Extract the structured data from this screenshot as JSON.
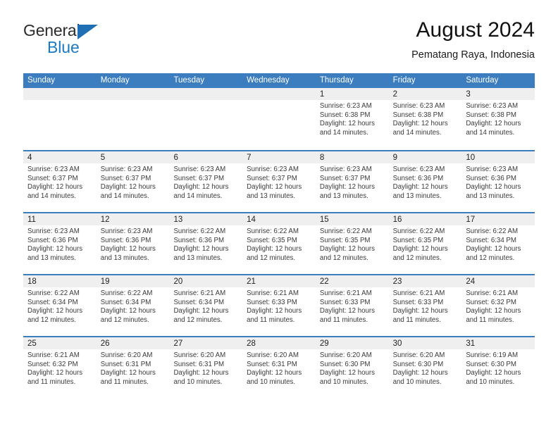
{
  "brand": {
    "name_part1": "General",
    "name_part2": "Blue",
    "logo_icon": "blue-triangle-logo"
  },
  "header": {
    "title": "August 2024",
    "subtitle": "Pematang Raya, Indonesia"
  },
  "colors": {
    "header_blue": "#3b7dbf",
    "brand_blue": "#1c7ac4",
    "daynum_band": "#efefef",
    "text": "#3a3a3a"
  },
  "calendar": {
    "day_headers": [
      "Sunday",
      "Monday",
      "Tuesday",
      "Wednesday",
      "Thursday",
      "Friday",
      "Saturday"
    ],
    "weeks": [
      [
        {
          "day": "",
          "sunrise": "",
          "sunset": "",
          "daylight1": "",
          "daylight2": ""
        },
        {
          "day": "",
          "sunrise": "",
          "sunset": "",
          "daylight1": "",
          "daylight2": ""
        },
        {
          "day": "",
          "sunrise": "",
          "sunset": "",
          "daylight1": "",
          "daylight2": ""
        },
        {
          "day": "",
          "sunrise": "",
          "sunset": "",
          "daylight1": "",
          "daylight2": ""
        },
        {
          "day": "1",
          "sunrise": "Sunrise: 6:23 AM",
          "sunset": "Sunset: 6:38 PM",
          "daylight1": "Daylight: 12 hours",
          "daylight2": "and 14 minutes."
        },
        {
          "day": "2",
          "sunrise": "Sunrise: 6:23 AM",
          "sunset": "Sunset: 6:38 PM",
          "daylight1": "Daylight: 12 hours",
          "daylight2": "and 14 minutes."
        },
        {
          "day": "3",
          "sunrise": "Sunrise: 6:23 AM",
          "sunset": "Sunset: 6:38 PM",
          "daylight1": "Daylight: 12 hours",
          "daylight2": "and 14 minutes."
        }
      ],
      [
        {
          "day": "4",
          "sunrise": "Sunrise: 6:23 AM",
          "sunset": "Sunset: 6:37 PM",
          "daylight1": "Daylight: 12 hours",
          "daylight2": "and 14 minutes."
        },
        {
          "day": "5",
          "sunrise": "Sunrise: 6:23 AM",
          "sunset": "Sunset: 6:37 PM",
          "daylight1": "Daylight: 12 hours",
          "daylight2": "and 14 minutes."
        },
        {
          "day": "6",
          "sunrise": "Sunrise: 6:23 AM",
          "sunset": "Sunset: 6:37 PM",
          "daylight1": "Daylight: 12 hours",
          "daylight2": "and 14 minutes."
        },
        {
          "day": "7",
          "sunrise": "Sunrise: 6:23 AM",
          "sunset": "Sunset: 6:37 PM",
          "daylight1": "Daylight: 12 hours",
          "daylight2": "and 13 minutes."
        },
        {
          "day": "8",
          "sunrise": "Sunrise: 6:23 AM",
          "sunset": "Sunset: 6:37 PM",
          "daylight1": "Daylight: 12 hours",
          "daylight2": "and 13 minutes."
        },
        {
          "day": "9",
          "sunrise": "Sunrise: 6:23 AM",
          "sunset": "Sunset: 6:36 PM",
          "daylight1": "Daylight: 12 hours",
          "daylight2": "and 13 minutes."
        },
        {
          "day": "10",
          "sunrise": "Sunrise: 6:23 AM",
          "sunset": "Sunset: 6:36 PM",
          "daylight1": "Daylight: 12 hours",
          "daylight2": "and 13 minutes."
        }
      ],
      [
        {
          "day": "11",
          "sunrise": "Sunrise: 6:23 AM",
          "sunset": "Sunset: 6:36 PM",
          "daylight1": "Daylight: 12 hours",
          "daylight2": "and 13 minutes."
        },
        {
          "day": "12",
          "sunrise": "Sunrise: 6:23 AM",
          "sunset": "Sunset: 6:36 PM",
          "daylight1": "Daylight: 12 hours",
          "daylight2": "and 13 minutes."
        },
        {
          "day": "13",
          "sunrise": "Sunrise: 6:22 AM",
          "sunset": "Sunset: 6:36 PM",
          "daylight1": "Daylight: 12 hours",
          "daylight2": "and 13 minutes."
        },
        {
          "day": "14",
          "sunrise": "Sunrise: 6:22 AM",
          "sunset": "Sunset: 6:35 PM",
          "daylight1": "Daylight: 12 hours",
          "daylight2": "and 12 minutes."
        },
        {
          "day": "15",
          "sunrise": "Sunrise: 6:22 AM",
          "sunset": "Sunset: 6:35 PM",
          "daylight1": "Daylight: 12 hours",
          "daylight2": "and 12 minutes."
        },
        {
          "day": "16",
          "sunrise": "Sunrise: 6:22 AM",
          "sunset": "Sunset: 6:35 PM",
          "daylight1": "Daylight: 12 hours",
          "daylight2": "and 12 minutes."
        },
        {
          "day": "17",
          "sunrise": "Sunrise: 6:22 AM",
          "sunset": "Sunset: 6:34 PM",
          "daylight1": "Daylight: 12 hours",
          "daylight2": "and 12 minutes."
        }
      ],
      [
        {
          "day": "18",
          "sunrise": "Sunrise: 6:22 AM",
          "sunset": "Sunset: 6:34 PM",
          "daylight1": "Daylight: 12 hours",
          "daylight2": "and 12 minutes."
        },
        {
          "day": "19",
          "sunrise": "Sunrise: 6:22 AM",
          "sunset": "Sunset: 6:34 PM",
          "daylight1": "Daylight: 12 hours",
          "daylight2": "and 12 minutes."
        },
        {
          "day": "20",
          "sunrise": "Sunrise: 6:21 AM",
          "sunset": "Sunset: 6:34 PM",
          "daylight1": "Daylight: 12 hours",
          "daylight2": "and 12 minutes."
        },
        {
          "day": "21",
          "sunrise": "Sunrise: 6:21 AM",
          "sunset": "Sunset: 6:33 PM",
          "daylight1": "Daylight: 12 hours",
          "daylight2": "and 11 minutes."
        },
        {
          "day": "22",
          "sunrise": "Sunrise: 6:21 AM",
          "sunset": "Sunset: 6:33 PM",
          "daylight1": "Daylight: 12 hours",
          "daylight2": "and 11 minutes."
        },
        {
          "day": "23",
          "sunrise": "Sunrise: 6:21 AM",
          "sunset": "Sunset: 6:33 PM",
          "daylight1": "Daylight: 12 hours",
          "daylight2": "and 11 minutes."
        },
        {
          "day": "24",
          "sunrise": "Sunrise: 6:21 AM",
          "sunset": "Sunset: 6:32 PM",
          "daylight1": "Daylight: 12 hours",
          "daylight2": "and 11 minutes."
        }
      ],
      [
        {
          "day": "25",
          "sunrise": "Sunrise: 6:21 AM",
          "sunset": "Sunset: 6:32 PM",
          "daylight1": "Daylight: 12 hours",
          "daylight2": "and 11 minutes."
        },
        {
          "day": "26",
          "sunrise": "Sunrise: 6:20 AM",
          "sunset": "Sunset: 6:31 PM",
          "daylight1": "Daylight: 12 hours",
          "daylight2": "and 11 minutes."
        },
        {
          "day": "27",
          "sunrise": "Sunrise: 6:20 AM",
          "sunset": "Sunset: 6:31 PM",
          "daylight1": "Daylight: 12 hours",
          "daylight2": "and 10 minutes."
        },
        {
          "day": "28",
          "sunrise": "Sunrise: 6:20 AM",
          "sunset": "Sunset: 6:31 PM",
          "daylight1": "Daylight: 12 hours",
          "daylight2": "and 10 minutes."
        },
        {
          "day": "29",
          "sunrise": "Sunrise: 6:20 AM",
          "sunset": "Sunset: 6:30 PM",
          "daylight1": "Daylight: 12 hours",
          "daylight2": "and 10 minutes."
        },
        {
          "day": "30",
          "sunrise": "Sunrise: 6:20 AM",
          "sunset": "Sunset: 6:30 PM",
          "daylight1": "Daylight: 12 hours",
          "daylight2": "and 10 minutes."
        },
        {
          "day": "31",
          "sunrise": "Sunrise: 6:19 AM",
          "sunset": "Sunset: 6:30 PM",
          "daylight1": "Daylight: 12 hours",
          "daylight2": "and 10 minutes."
        }
      ]
    ]
  }
}
